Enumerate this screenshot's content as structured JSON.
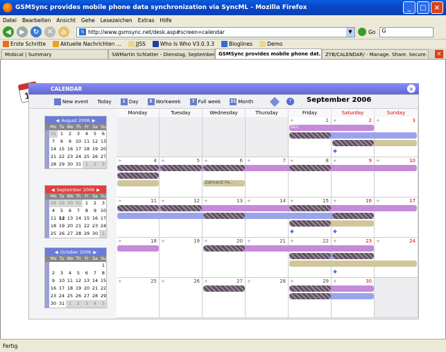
{
  "window": {
    "title": "GSMSync provides mobile phone data synchronization via SyncML - Mozilla Firefox"
  },
  "menu": [
    "Datei",
    "Bearbeiten",
    "Ansicht",
    "Gehe",
    "Lesezeichen",
    "Extras",
    "Hilfe"
  ],
  "nav": {
    "url": "http://www.gsmsync.net/desk.asp#screen=calendar",
    "go_label": "Go"
  },
  "bookmarks": [
    "Erste Schritte",
    "Aktuelle Nachrichten ...",
    "JJSS",
    "Who Is Who V3.0.3.3",
    "Bloglines",
    "Demo"
  ],
  "tabs": [
    "Mobical | Summary",
    "SWMartin Schlatter - Dienstag, September 12 ...",
    "GSMSync provides mobile phone dat...",
    "ZYB/CALENDAR/ - Manage. Share. Secure."
  ],
  "status": "Fertig",
  "calendar": {
    "header": "CALENDAR",
    "icon_number": "14",
    "toolbar": {
      "new_event": "New event",
      "today": "Today",
      "day": "Day",
      "workweek": "Workweek",
      "full_week": "Full week",
      "month": "Month"
    },
    "month_title": "September 2006",
    "day_names": [
      "Monday",
      "Tuesday",
      "Wednesday",
      "Thursday",
      "Friday",
      "Saturday",
      "Sunday"
    ],
    "weeks": [
      [
        "",
        "",
        "",
        "",
        "1",
        "2",
        "3"
      ],
      [
        "4",
        "5",
        "6",
        "7",
        "8",
        "9",
        "10"
      ],
      [
        "11",
        "12",
        "13",
        "14",
        "15",
        "16",
        "17"
      ],
      [
        "18",
        "19",
        "20",
        "21",
        "22",
        "23",
        "24"
      ],
      [
        "25",
        "26",
        "27",
        "28",
        "29",
        "30",
        ""
      ]
    ],
    "event_labels": {
      "dlc": "DLC",
      "zahnarzt": "Zahnarzt Fe..."
    }
  },
  "mini": [
    {
      "title": "August 2006",
      "color": "blue",
      "rows": [
        [
          "31",
          "1",
          "2",
          "3",
          "4",
          "5",
          "6"
        ],
        [
          "7",
          "8",
          "9",
          "10",
          "11",
          "12",
          "13"
        ],
        [
          "14",
          "15",
          "16",
          "17",
          "18",
          "19",
          "20"
        ],
        [
          "21",
          "22",
          "23",
          "24",
          "25",
          "26",
          "27"
        ],
        [
          "28",
          "29",
          "30",
          "31",
          "1",
          "2",
          "3"
        ]
      ]
    },
    {
      "title": "September 2006",
      "color": "red",
      "rows": [
        [
          "28",
          "29",
          "30",
          "31",
          "1",
          "2",
          "3"
        ],
        [
          "4",
          "5",
          "6",
          "7",
          "8",
          "9",
          "10"
        ],
        [
          "11",
          "12",
          "13",
          "14",
          "15",
          "16",
          "17"
        ],
        [
          "18",
          "19",
          "20",
          "21",
          "22",
          "23",
          "24"
        ],
        [
          "25",
          "26",
          "27",
          "28",
          "29",
          "30",
          "1"
        ]
      ]
    },
    {
      "title": "October 2006",
      "color": "blue",
      "rows": [
        [
          "",
          "",
          "",
          "",
          "",
          "",
          "1"
        ],
        [
          "2",
          "3",
          "4",
          "5",
          "6",
          "7",
          "8"
        ],
        [
          "9",
          "10",
          "11",
          "12",
          "13",
          "14",
          "15"
        ],
        [
          "16",
          "17",
          "18",
          "19",
          "20",
          "21",
          "22"
        ],
        [
          "23",
          "24",
          "25",
          "26",
          "27",
          "28",
          "29"
        ],
        [
          "30",
          "31",
          "1",
          "2",
          "3",
          "4",
          "5"
        ]
      ]
    }
  ],
  "mini_days": [
    "Mo",
    "Tu",
    "We",
    "Th",
    "Fr",
    "Sa",
    "Su"
  ]
}
